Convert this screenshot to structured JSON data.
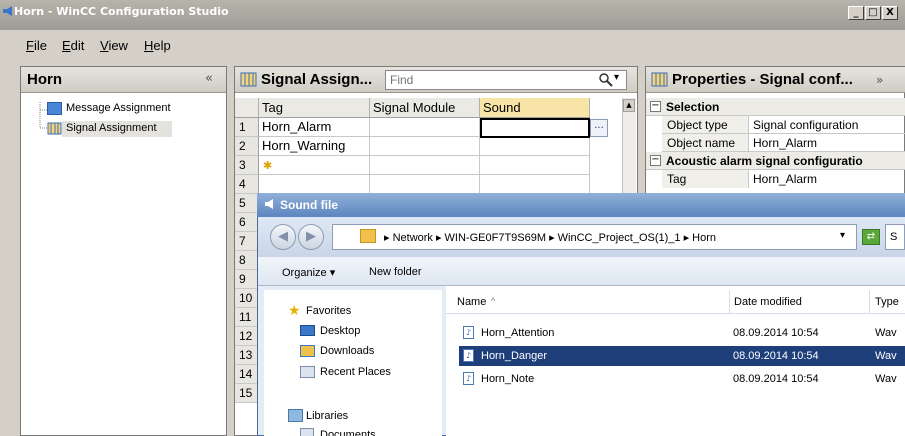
{
  "window": {
    "title": "Horn - WinCC Configuration Studio",
    "buttons": [
      "_",
      "□",
      "X"
    ]
  },
  "menu": [
    {
      "label": "File",
      "key": "F",
      "rest": "ile"
    },
    {
      "label": "Edit",
      "key": "E",
      "rest": "dit"
    },
    {
      "label": "View",
      "key": "V",
      "rest": "iew"
    },
    {
      "label": "Help",
      "key": "H",
      "rest": "elp"
    }
  ],
  "nav": {
    "title": "Horn",
    "collapse": "«",
    "items": [
      {
        "label": "Message Assignment"
      },
      {
        "label": "Signal Assignment"
      }
    ]
  },
  "grid": {
    "title": "Signal Assign...",
    "find_placeholder": "Find",
    "columns": [
      "Tag",
      "Signal Module",
      "Sound"
    ],
    "rows": [
      {
        "n": "1",
        "tag": "Horn_Alarm"
      },
      {
        "n": "2",
        "tag": "Horn_Warning"
      },
      {
        "n": "3",
        "tag": ""
      },
      {
        "n": "4",
        "tag": ""
      },
      {
        "n": "5",
        "tag": ""
      },
      {
        "n": "6",
        "tag": ""
      },
      {
        "n": "7",
        "tag": ""
      },
      {
        "n": "8",
        "tag": ""
      },
      {
        "n": "9",
        "tag": ""
      },
      {
        "n": "10",
        "tag": ""
      },
      {
        "n": "11",
        "tag": ""
      },
      {
        "n": "12",
        "tag": ""
      },
      {
        "n": "13",
        "tag": ""
      },
      {
        "n": "14",
        "tag": ""
      },
      {
        "n": "15",
        "tag": ""
      }
    ],
    "browse_button": "..."
  },
  "properties": {
    "title": "Properties - Signal conf...",
    "expand": "»",
    "sections": [
      {
        "name": "Selection",
        "rows": [
          {
            "label": "Object type",
            "value": "Signal configuration"
          },
          {
            "label": "Object name",
            "value": "Horn_Alarm"
          }
        ]
      },
      {
        "name": "Acoustic alarm signal configuratio",
        "rows": [
          {
            "label": "Tag",
            "value": "Horn_Alarm"
          }
        ]
      }
    ]
  },
  "dialog": {
    "title": "Sound file",
    "breadcrumb": "▸ Network ▸ WIN-GE0F7T9S69M ▸ WinCC_Project_OS(1)_1 ▸ Horn",
    "search_partial": "S",
    "organize": "Organize ▾",
    "new_folder": "New folder",
    "nav_pane": {
      "favorites": "Favorites",
      "items": [
        "Desktop",
        "Downloads",
        "Recent Places"
      ],
      "libraries": "Libraries",
      "lib_items": [
        "Documents"
      ]
    },
    "columns": {
      "name": "Name",
      "sort": "^",
      "date": "Date modified",
      "type": "Type"
    },
    "files": [
      {
        "name": "Horn_Attention",
        "date": "08.09.2014 10:54",
        "type": "Wav",
        "selected": false
      },
      {
        "name": "Horn_Danger",
        "date": "08.09.2014 10:54",
        "type": "Wav",
        "selected": true
      },
      {
        "name": "Horn_Note",
        "date": "08.09.2014 10:54",
        "type": "Wav",
        "selected": false
      }
    ]
  }
}
